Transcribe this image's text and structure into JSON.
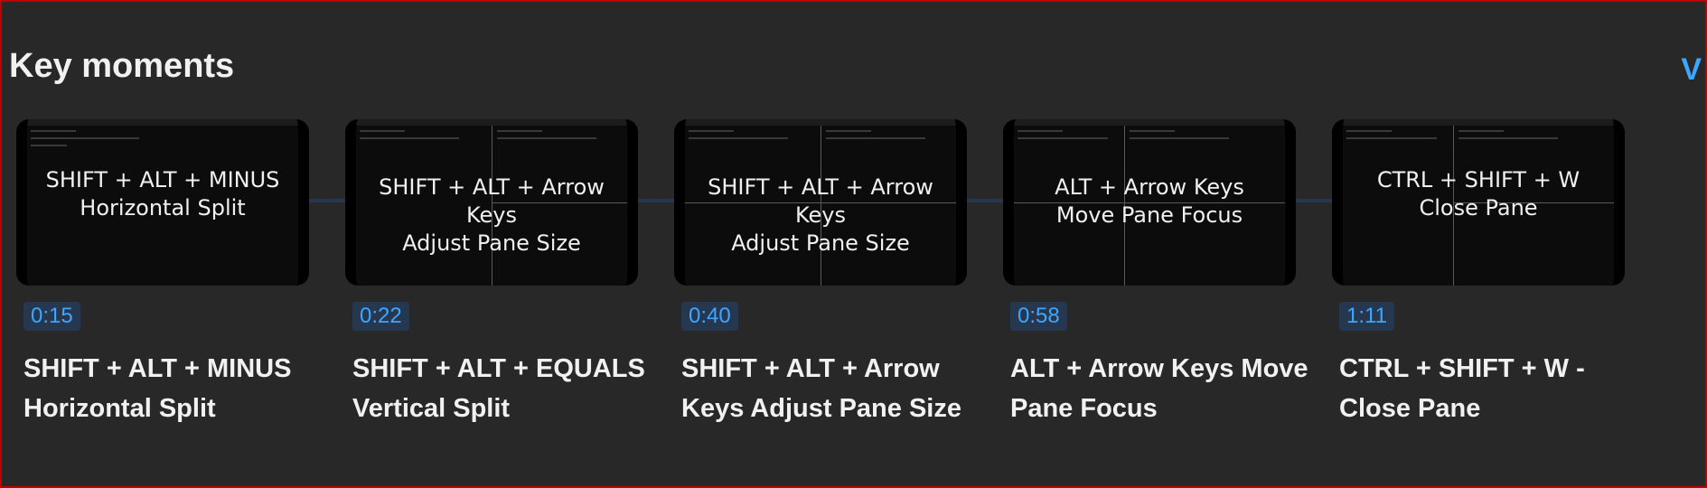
{
  "section": {
    "title": "Key moments",
    "view_all": "V"
  },
  "moments": [
    {
      "time": "0:15",
      "thumb_line1": "SHIFT + ALT + MINUS",
      "thumb_line2": "Horizontal Split",
      "label": "SHIFT + ALT + MINUS Horizontal Split"
    },
    {
      "time": "0:22",
      "thumb_line1": "SHIFT + ALT + Arrow Keys",
      "thumb_line2": "Adjust Pane Size",
      "label": "SHIFT + ALT + EQUALS Vertical Split"
    },
    {
      "time": "0:40",
      "thumb_line1": "SHIFT + ALT + Arrow Keys",
      "thumb_line2": "Adjust Pane Size",
      "label": "SHIFT + ALT + Arrow Keys Adjust Pane Size"
    },
    {
      "time": "0:58",
      "thumb_line1": "ALT + Arrow Keys",
      "thumb_line2": "Move Pane Focus",
      "label": "ALT + Arrow Keys Move Pane Focus"
    },
    {
      "time": "1:11",
      "thumb_line1": "CTRL + SHIFT + W",
      "thumb_line2": "Close Pane",
      "label": "CTRL + SHIFT + W - Close Pane"
    }
  ]
}
